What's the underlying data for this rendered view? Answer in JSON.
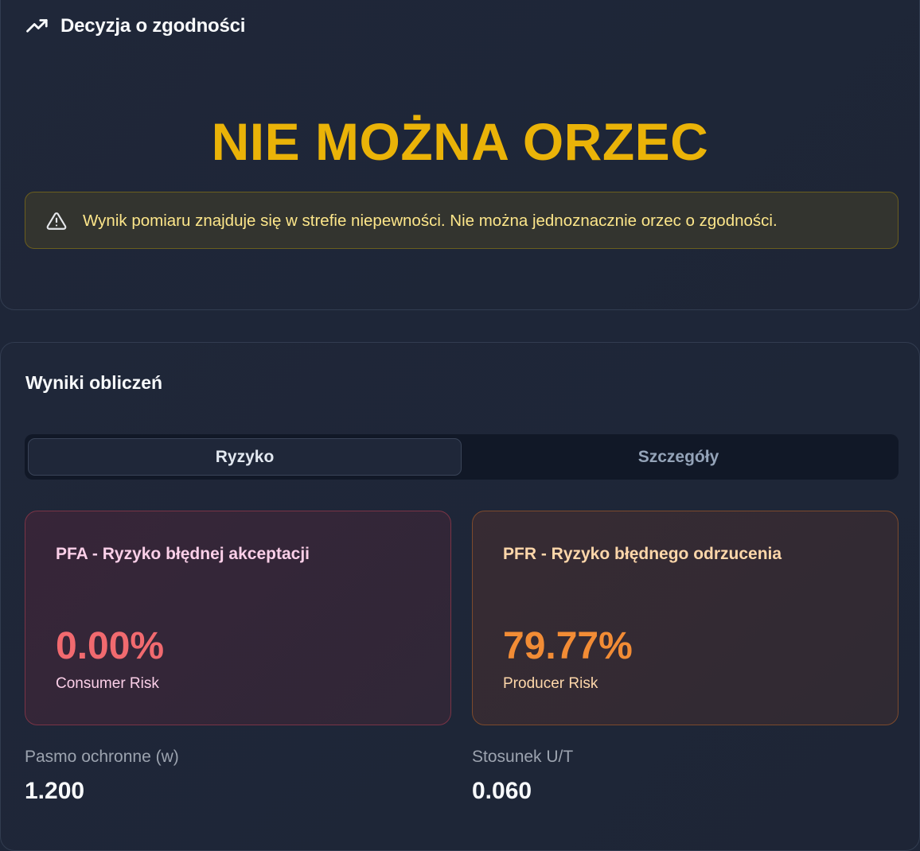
{
  "decision": {
    "title": "Decyzja o zgodności",
    "title_icon": "trending-up-icon",
    "verdict": "NIE MOŻNA ORZEC",
    "verdict_color": "#eab308",
    "alert": {
      "icon": "warning-triangle-icon",
      "text": "Wynik pomiaru znajduje się w strefie niepewności. Nie można jednoznacznie orzec o zgodności."
    }
  },
  "results": {
    "title": "Wyniki obliczeń",
    "tabs": [
      {
        "label": "Ryzyko",
        "active": true
      },
      {
        "label": "Szczegóły",
        "active": false
      }
    ],
    "pfa": {
      "title": "PFA - Ryzyko błędnej akceptacji",
      "value": "0.00%",
      "subtitle": "Consumer Risk",
      "color": "#f16a6f"
    },
    "pfr": {
      "title": "PFR - Ryzyko błędnego odrzucenia",
      "value": "79.77%",
      "subtitle": "Producer Risk",
      "color": "#f28c35"
    },
    "metrics": [
      {
        "label": "Pasmo ochronne (w)",
        "value": "1.200"
      },
      {
        "label": "Stosunek U/T",
        "value": "0.060"
      }
    ]
  }
}
